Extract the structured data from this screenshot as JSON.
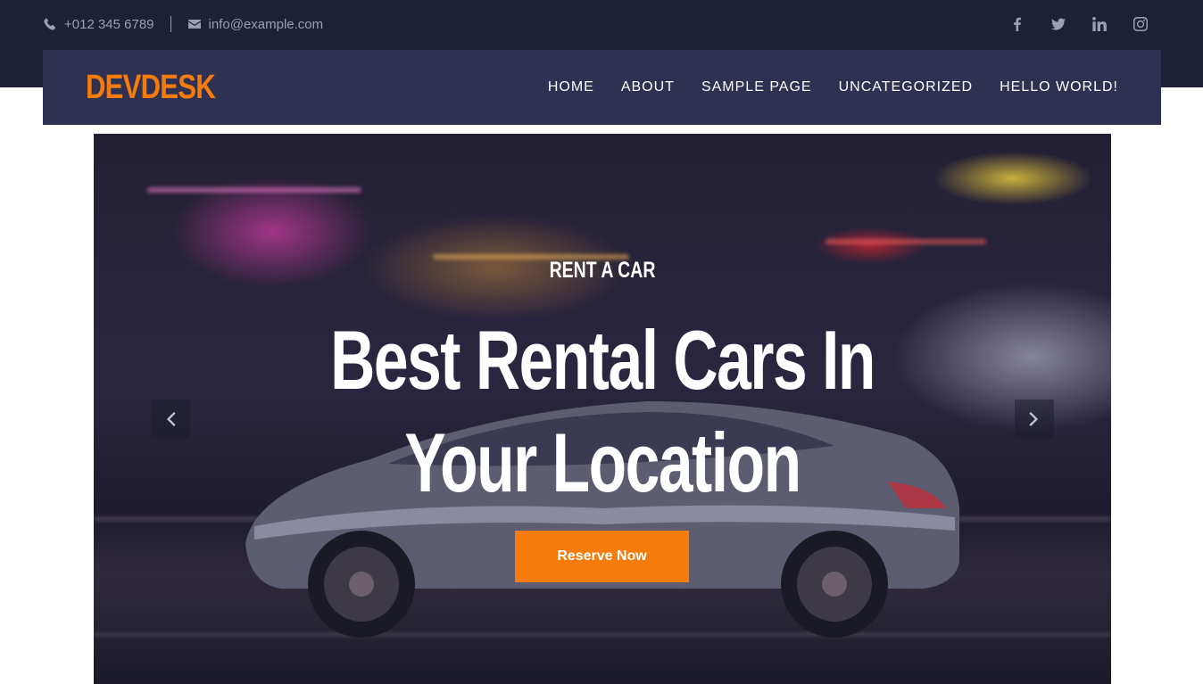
{
  "topbar": {
    "phone": "+012 345 6789",
    "email": "info@example.com",
    "social_icons": [
      "facebook-icon",
      "twitter-icon",
      "linkedin-icon",
      "instagram-icon"
    ]
  },
  "navbar": {
    "logo": "DEVDESK",
    "menu": [
      {
        "label": "HOME"
      },
      {
        "label": "ABOUT"
      },
      {
        "label": "SAMPLE PAGE"
      },
      {
        "label": "UNCATEGORIZED"
      },
      {
        "label": "HELLO WORLD!"
      }
    ]
  },
  "hero": {
    "subtitle": "RENT A CAR",
    "headline": "Best Rental Cars In Your Location",
    "button_label": "Reserve Now",
    "prev_icon": "chevron-left-icon",
    "next_icon": "chevron-right-icon"
  },
  "colors": {
    "topbar_bg": "#1e2136",
    "navbar_bg": "#2e3152",
    "accent": "#f57c0c",
    "muted_text": "#9aa0b4"
  }
}
